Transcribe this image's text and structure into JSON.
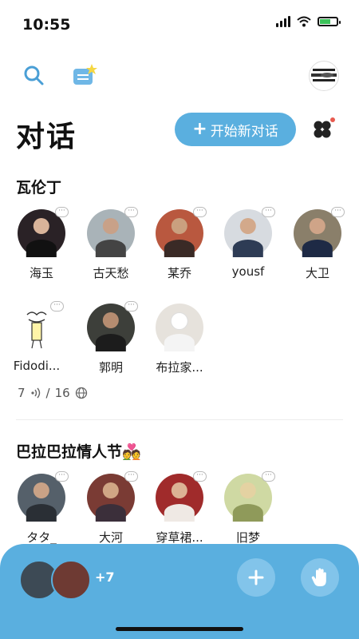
{
  "status_bar": {
    "time": "10:55"
  },
  "header": {
    "title": "对话",
    "new_chat_button": {
      "plus": "+",
      "label": "开始新对话"
    }
  },
  "sections": [
    {
      "title": "瓦伦丁",
      "people": [
        {
          "name": "海玉"
        },
        {
          "name": "古天愁"
        },
        {
          "name": "某乔"
        },
        {
          "name": "yousf"
        },
        {
          "name": "大卫"
        },
        {
          "name": "Fidodi..."
        },
        {
          "name": "郭明"
        },
        {
          "name": "布拉家..."
        }
      ],
      "counts": {
        "listening": "7",
        "separator": "/",
        "total": "16"
      }
    },
    {
      "title": "巴拉巴拉情人节💑",
      "people": [
        {
          "name": "タタ_"
        },
        {
          "name": "大河"
        },
        {
          "name": "穿草裙..."
        },
        {
          "name": "旧梦"
        }
      ]
    }
  ],
  "bottom_bar": {
    "more_count": "+7"
  },
  "colors": {
    "accent": "#5aafdf",
    "text": "#111111",
    "notification_dot": "#e85a4f"
  },
  "icons": [
    "search-icon",
    "envelope-icon",
    "profile-avatar",
    "clover-icon",
    "sound-icon",
    "globe-icon",
    "plus-icon",
    "raise-hand-icon"
  ]
}
